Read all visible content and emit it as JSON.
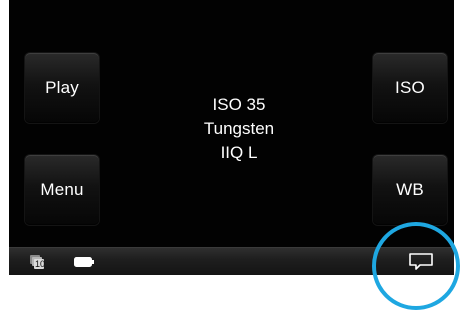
{
  "buttons": {
    "play": "Play",
    "menu": "Menu",
    "iso": "ISO",
    "wb": "WB"
  },
  "status": {
    "iso": "ISO 35",
    "white_balance": "Tungsten",
    "quality": "IIQ L"
  },
  "statusbar": {
    "cards_count": "10",
    "icons": [
      "cards-icon",
      "battery-icon",
      "chat-icon"
    ]
  },
  "colors": {
    "screen": "#020202",
    "highlight_ring": "#1ea7e1"
  }
}
